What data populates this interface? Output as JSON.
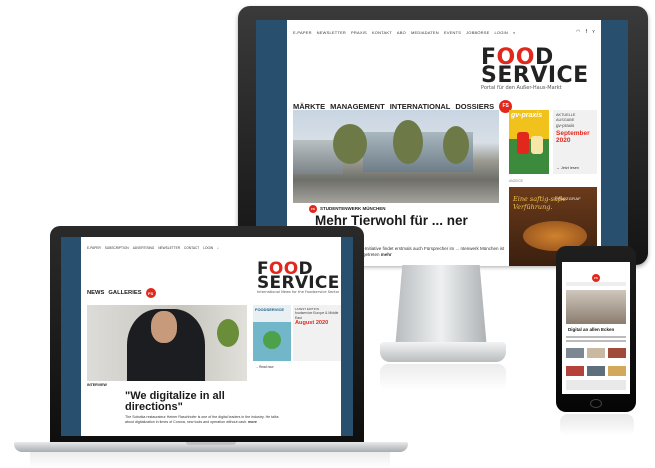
{
  "desktop": {
    "topnav": [
      "E-PAPER",
      "NEWSLETTER",
      "PRAXIS",
      "KONTAKT",
      "ABO",
      "MEDIADATEN",
      "EVENTS",
      "JOBBÖRSE",
      "LOGIN"
    ],
    "social_icons": [
      "rss-icon",
      "facebook-icon",
      "twitter-icon"
    ],
    "logo": {
      "line1": "FOOD",
      "line2": "SERVICE",
      "tagline": "Portal für den Außer-Haus-Markt"
    },
    "mainnav": [
      "MÄRKTE",
      "MANAGEMENT",
      "INTERNATIONAL",
      "DOSSIERS"
    ],
    "fs_badge": "FS",
    "article": {
      "kicker": "STUDENTENWERK MÜNCHEN",
      "headline": "Mehr Tierwohl für ... ner",
      "teaser": "...n-Initiative findet erstmals auch Fürsprecher im ... ntenwerk München ist beigetreten",
      "more": "mehr"
    },
    "magazine": {
      "masthead": "gv-praxis",
      "label": "AKTUELLE AUSGABE",
      "title": "gv-praxis",
      "date": "September 2020",
      "more": "→ Jetzt lesen"
    },
    "ad": {
      "label": "ANZEIGE",
      "slogan": "Eine saftig-süße Verführung.",
      "brand": "PFALZGRAF"
    }
  },
  "laptop": {
    "topnav": [
      "E-PAPER",
      "SUBSCRIPTION",
      "ADVERTISING",
      "NEWSLETTER",
      "CONTACT",
      "LOGIN"
    ],
    "logo": {
      "line1": "FOOD",
      "line2": "SERVICE",
      "tagline": "International News for the Foodservice Sector"
    },
    "mainnav": [
      "NEWS",
      "GALLERIES"
    ],
    "fs_badge": "FS",
    "article": {
      "kicker": "INTERVIEW",
      "headline": "\"We digitalize in all directions\"",
      "teaser": "The Sobotka restaurateur Heiner Raschhofer is one of the digital leaders in the industry. He talks about digitalization in times of Corona, new tools and operation without cash.",
      "more": "more"
    },
    "magazine": {
      "masthead": "FOODSERVICE",
      "label": "LATEST EDITION",
      "title": "foodservice Europe & Middle East",
      "date": "August 2020",
      "more": "→ Read now"
    }
  },
  "phone": {
    "fs_badge": "FS",
    "headline": "Digital an allen Ecken"
  }
}
